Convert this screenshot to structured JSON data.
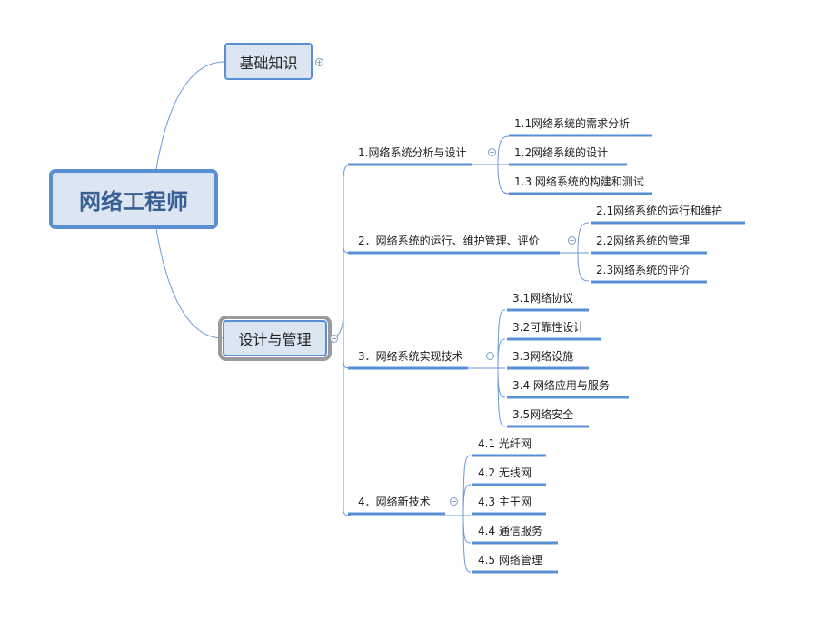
{
  "root": {
    "label": "网络工程师"
  },
  "main_topics": [
    {
      "label": "基础知识",
      "collapsed": true
    },
    {
      "label": "设计与管理",
      "collapsed": false,
      "selected": true
    }
  ],
  "subtopics": [
    {
      "label": "1.网络系统分析与设计",
      "children": [
        "1.1网络系统的需求分析",
        "1.2网络系统的设计",
        "1.3 网络系统的构建和测试"
      ]
    },
    {
      "label": "2．网络系统的运行、维护管理、评价",
      "children": [
        "2.1网络系统的运行和维护",
        "2.2网络系统的管理",
        "2.3网络系统的评价"
      ]
    },
    {
      "label": "3．网络系统实现技术",
      "children": [
        "3.1网络协议",
        "3.2可靠性设计",
        "3.3网络设施",
        "3.4 网络应用与服务",
        "3.5网络安全"
      ]
    },
    {
      "label": "4．网络新技术",
      "children": [
        "4.1 光纤网",
        "4.2 无线网",
        "4.3 主干网",
        "4.4 通信服务",
        "4.5 网络管理"
      ]
    }
  ],
  "toggles": {
    "expand": "+",
    "collapse": "−"
  },
  "colors": {
    "line": "#5b8fd4",
    "node_fill": "#dce6f3",
    "selection": "#9a9a9a"
  }
}
